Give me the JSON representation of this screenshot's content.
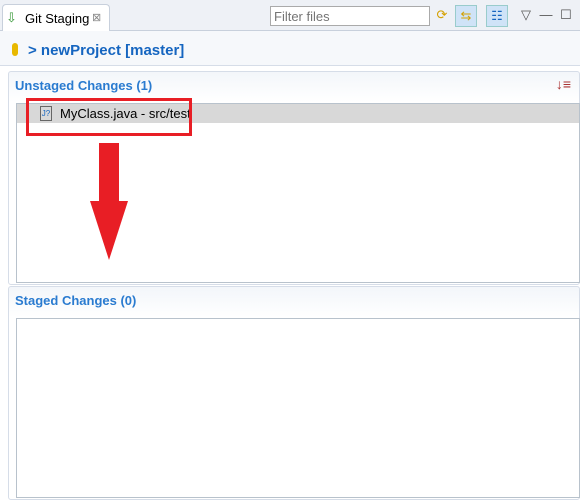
{
  "tab": {
    "title": "Git Staging",
    "close": "⊠"
  },
  "filter": {
    "placeholder": "Filter files"
  },
  "repo": {
    "label": "> newProject [master]"
  },
  "unstaged": {
    "title": "Unstaged Changes (1)",
    "files": [
      {
        "label": "MyClass.java - src/test"
      }
    ]
  },
  "staged": {
    "title": "Staged Changes (0)"
  },
  "annotation_color": "#e81e25"
}
